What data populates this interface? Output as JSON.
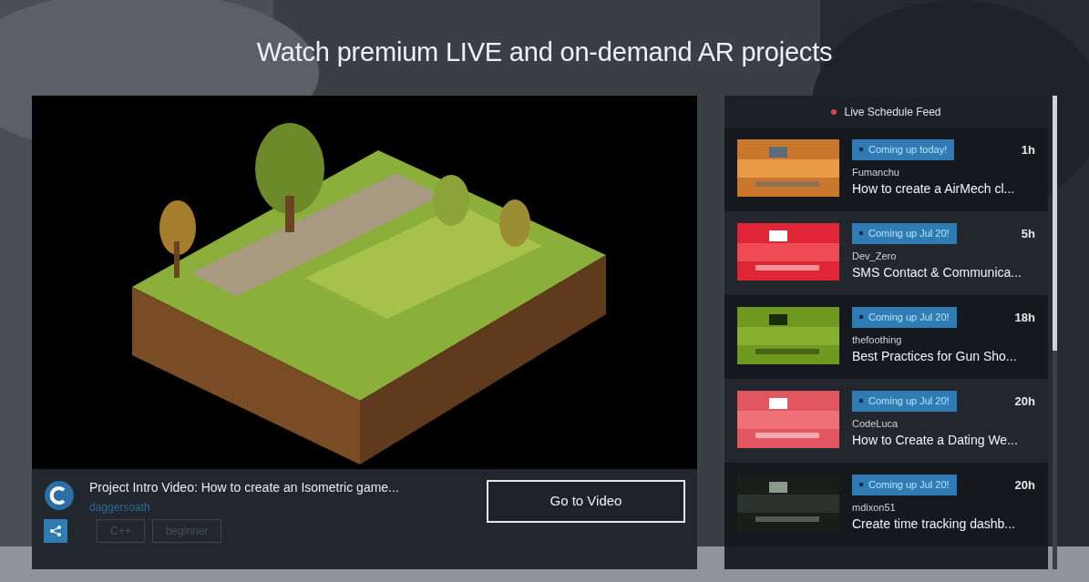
{
  "heading": "Watch premium LIVE and on-demand AR projects",
  "video": {
    "title": "Project Intro Video: How to create an Isometric game...",
    "author": "daggersoath",
    "tags": [
      "C++",
      "beginner"
    ],
    "button": "Go to Video"
  },
  "feed": {
    "title": "Live Schedule Feed",
    "items": [
      {
        "badge": "Coming up today!",
        "time": "1h",
        "author": "Fumanchu",
        "title": "How to create a AirMech cl..."
      },
      {
        "badge": "Coming up Jul 20!",
        "time": "5h",
        "author": "Dev_Zero",
        "title": "SMS Contact & Communica..."
      },
      {
        "badge": "Coming up Jul 20!",
        "time": "18h",
        "author": "thefoothing",
        "title": "Best Practices for Gun Sho..."
      },
      {
        "badge": "Coming up Jul 20!",
        "time": "20h",
        "author": "CodeLuca",
        "title": "How to Create a Dating We..."
      },
      {
        "badge": "Coming up Jul 20!",
        "time": "20h",
        "author": "mdixon51",
        "title": "Create time tracking dashb..."
      }
    ]
  }
}
